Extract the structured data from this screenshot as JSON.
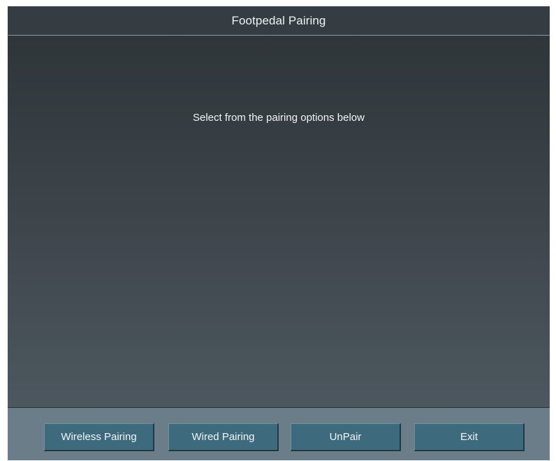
{
  "window": {
    "title": "Footpedal Pairing"
  },
  "main": {
    "prompt": "Select from the pairing options below"
  },
  "footer": {
    "buttons": [
      {
        "label": "Wireless Pairing"
      },
      {
        "label": "Wired Pairing"
      },
      {
        "label": "UnPair"
      },
      {
        "label": "Exit"
      }
    ]
  },
  "colors": {
    "background_dark": "#2e3438",
    "footer": "#6b7d88",
    "button": "#3e6a7d",
    "text": "#f1f5f7"
  }
}
